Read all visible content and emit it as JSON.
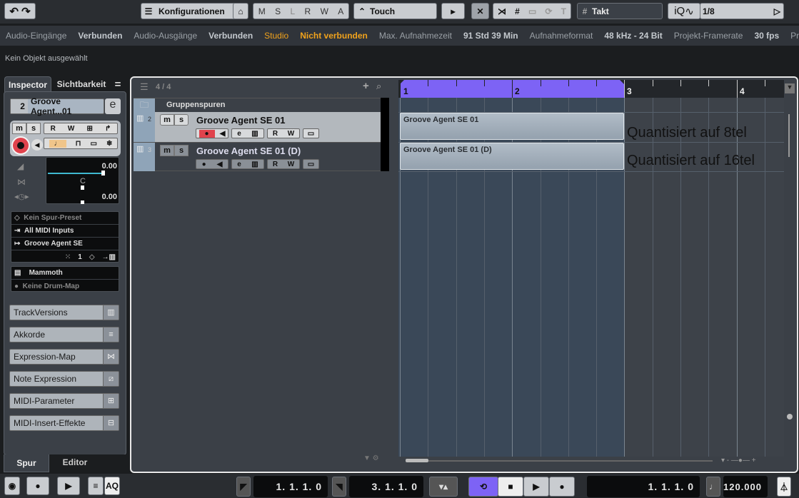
{
  "toolbar": {
    "config_label": "Konfigurationen",
    "msl": [
      "M",
      "S",
      "L"
    ],
    "rwa": [
      "R",
      "W",
      "A"
    ],
    "automation_mode": "Touch",
    "grid_type": "Takt",
    "quantize_value": "1/8",
    "iq": "iQ"
  },
  "status": {
    "items": [
      {
        "label": "Audio-Eingänge",
        "value": "Verbunden"
      },
      {
        "label": "Audio-Ausgänge",
        "value": "Verbunden"
      },
      {
        "label": "Studio",
        "value": "Nicht verbunden",
        "warn": true
      },
      {
        "label": "Max. Aufnahmezeit",
        "value": "91 Std 39 Min"
      },
      {
        "label": "Aufnahmeformat",
        "value": "48 kHz - 24 Bit"
      },
      {
        "label": "Projekt-Framerate",
        "value": "30 fps"
      },
      {
        "label": "Projek",
        "value": ""
      }
    ]
  },
  "info_line": "Kein Objekt ausgewählt",
  "inspector": {
    "tabs": [
      "Inspector",
      "Sichtbarkeit"
    ],
    "menu": "=",
    "track_num": "2",
    "track_name": "Groove Agent...01",
    "volume": "0.00",
    "pan": "C",
    "delay": "0.00",
    "preset": "Kein Spur-Preset",
    "input": "All MIDI Inputs",
    "output": "Groove Agent SE",
    "channel": "1",
    "drum_kit": "Mammoth",
    "drum_map": "Keine Drum-Map",
    "sections": [
      "TrackVersions",
      "Akkorde",
      "Expression-Map",
      "Note Expression",
      "MIDI-Parameter",
      "MIDI-Insert-Effekte"
    ],
    "bottom_tabs": [
      "Spur",
      "Editor"
    ]
  },
  "tracklist": {
    "count": "4 / 4",
    "folder": "Gruppenspuren",
    "tracks": [
      {
        "num": "2",
        "name": "Groove Agent SE 01",
        "selected": true
      },
      {
        "num": "3",
        "name": "Groove Agent SE 01 (D)",
        "selected": false
      }
    ]
  },
  "ruler": {
    "bars": [
      "1",
      "2",
      "3",
      "4"
    ]
  },
  "events": [
    {
      "name": "Groove Agent SE 01",
      "note": "Quantisiert auf 8tel"
    },
    {
      "name": "Groove Agent SE 01 (D)",
      "note": "Quantisiert auf 16tel"
    }
  ],
  "transport": {
    "aq": "AQ",
    "left_locator": "1. 1. 1.   0",
    "right_locator": "3. 1. 1.   0",
    "position": "1. 1. 1.   0",
    "tempo": "120.000"
  },
  "colors": {
    "accent": "#7d63f5",
    "record": "#e0434d",
    "warning": "#f0a21c"
  }
}
